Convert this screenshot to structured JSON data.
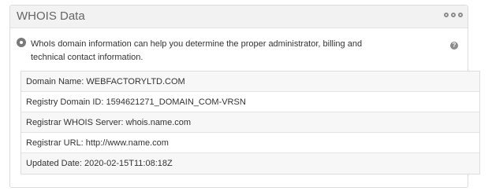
{
  "panel": {
    "title": "WHOIS Data"
  },
  "intro": {
    "text": "WhoIs domain information can help you determine the proper administrator, billing and technical contact information.",
    "help_glyph": "?"
  },
  "whois_rows": [
    "Domain Name: WEBFACTORYLTD.COM",
    "Registry Domain ID: 1594621271_DOMAIN_COM-VRSN",
    "Registrar WHOIS Server: whois.name.com",
    "Registrar URL: http://www.name.com",
    "Updated Date: 2020-02-15T11:08:18Z"
  ],
  "colors": {
    "header_bg": "#f2f2f2",
    "row_stripe": "#f7f7f7",
    "icon_gray": "#7a7a7a"
  },
  "icons": {
    "header_menu": "gear-dots-icon",
    "status": "radio-circle-icon",
    "help": "question-icon"
  }
}
